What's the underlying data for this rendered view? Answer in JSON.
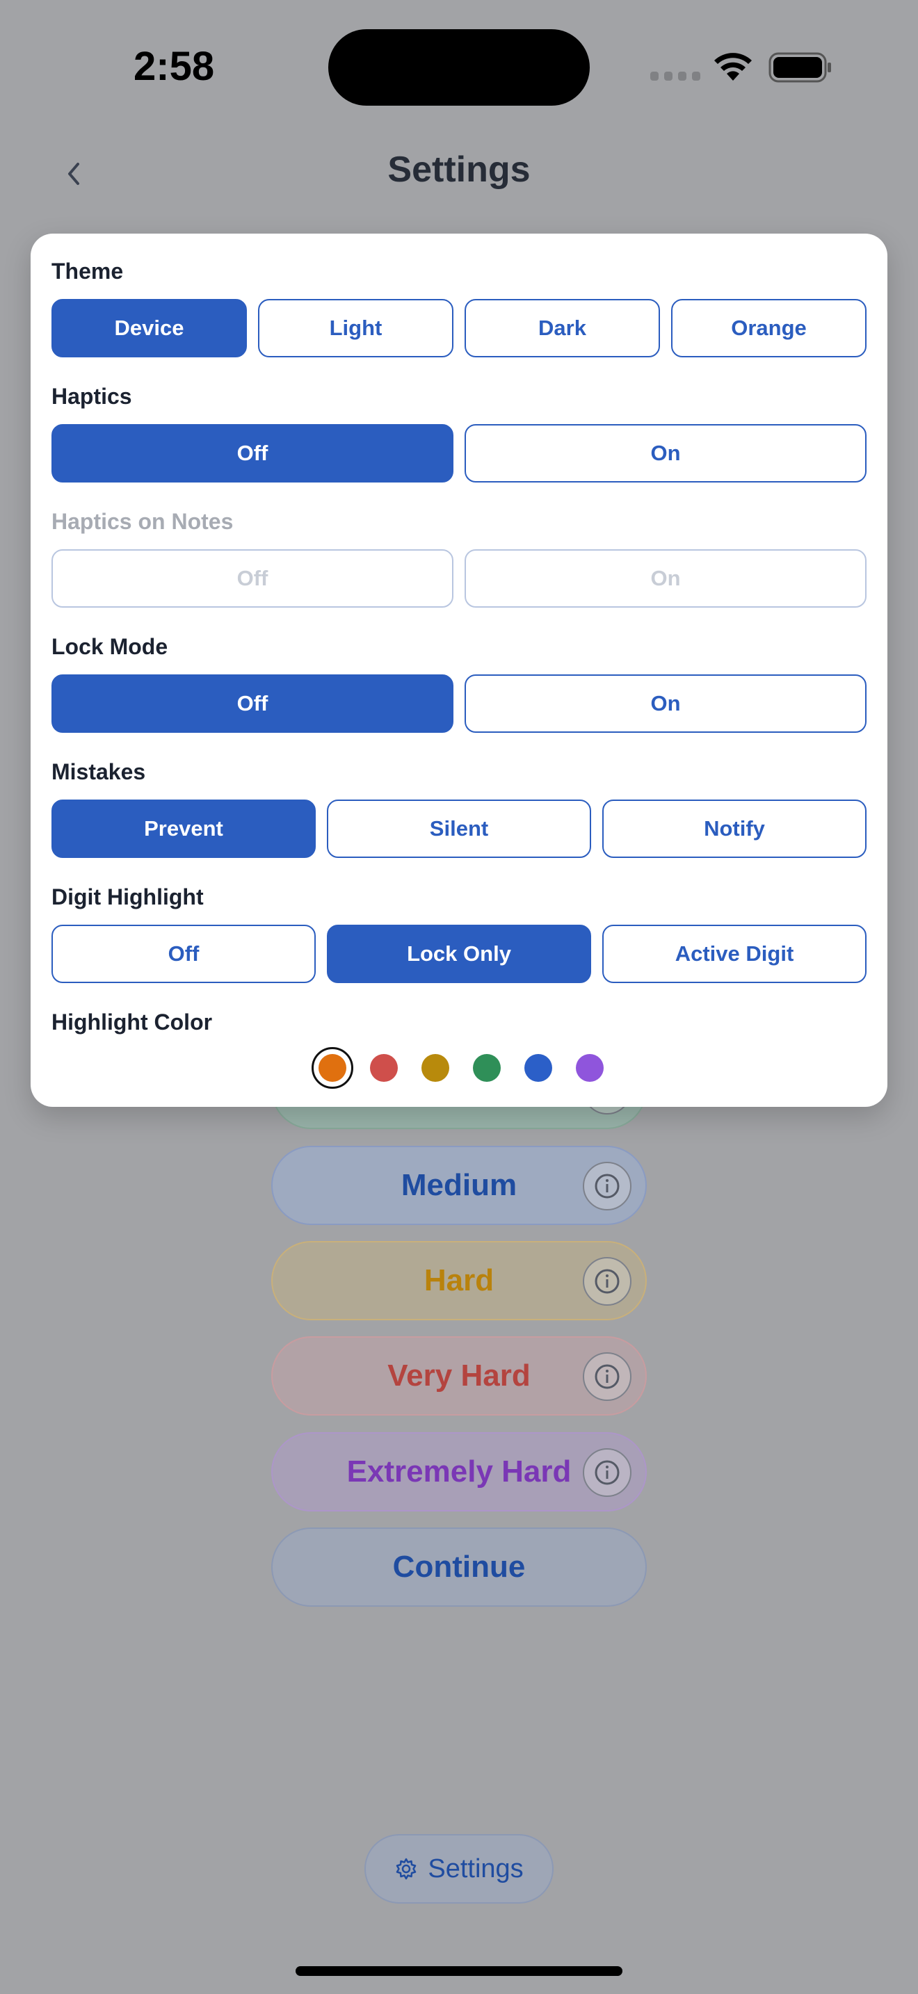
{
  "status_bar": {
    "time": "2:58"
  },
  "header": {
    "title": "Settings"
  },
  "difficulty": {
    "medium": "Medium",
    "hard": "Hard",
    "very_hard": "Very Hard",
    "extremely_hard": "Extremely Hard",
    "continue": "Continue"
  },
  "bottom": {
    "settings_label": "Settings"
  },
  "settings": {
    "theme": {
      "label": "Theme",
      "options": [
        "Device",
        "Light",
        "Dark",
        "Orange"
      ],
      "selected": "Device"
    },
    "haptics": {
      "label": "Haptics",
      "options": [
        "Off",
        "On"
      ],
      "selected": "Off"
    },
    "haptics_notes": {
      "label": "Haptics on Notes",
      "options": [
        "Off",
        "On"
      ],
      "disabled": true
    },
    "lock_mode": {
      "label": "Lock Mode",
      "options": [
        "Off",
        "On"
      ],
      "selected": "Off"
    },
    "mistakes": {
      "label": "Mistakes",
      "options": [
        "Prevent",
        "Silent",
        "Notify"
      ],
      "selected": "Prevent"
    },
    "digit_highlight": {
      "label": "Digit Highlight",
      "options": [
        "Off",
        "Lock Only",
        "Active Digit"
      ],
      "selected": "Lock Only"
    },
    "highlight_color": {
      "label": "Highlight Color",
      "colors": [
        "#e0700f",
        "#cf4f4b",
        "#b88a0c",
        "#2f8f58",
        "#2b5fc8",
        "#8f55dc"
      ],
      "selected_index": 0
    }
  }
}
